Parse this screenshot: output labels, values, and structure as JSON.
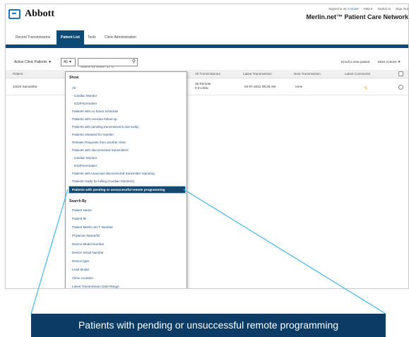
{
  "header": {
    "logo_text": "Abbott",
    "signed_in_prefix": "Signed in as",
    "user_name": "A Grant",
    "help_label": "Help ▾",
    "switch_label": "Switch to",
    "signout_label": "Sign Out",
    "network_title": "Merlin.net™ Patient Care Network"
  },
  "tabs": [
    {
      "label": "Recent Transmissions"
    },
    {
      "label": "Patient List"
    },
    {
      "label": "Tools"
    },
    {
      "label": "Clinic Administration"
    }
  ],
  "toolbar": {
    "filter_label": "Active Clinic Patients ▼",
    "filter_value": "All ▼",
    "search_placeholder": "Search by Name, ID, D",
    "enroll_label": "Enroll a new patient",
    "more_actions_label": "More Actions ▼"
  },
  "table": {
    "columns": [
      "Patient",
      "All Transmissions",
      "Latest Transmission",
      "Next Transmission",
      "Latest Comments"
    ],
    "rows": [
      {
        "patient": "Jones Samantha",
        "transmissions_line1": "25 Remote",
        "transmissions_line2": "0 In-clinic",
        "latest": "04-07-2022 08:25 AM",
        "next": "none"
      }
    ]
  },
  "dropdown": {
    "show_heading": "Show",
    "show_items": [
      "All",
      "- Cardiac Monitor",
      "- ICD/Pacemaker",
      "Patients with no future schedule",
      "Patients with overdue follow-up",
      "Patients with pending transmissions due today",
      "Patients released for transfer",
      "Release Requests from another clinic",
      "Patients with disconnected transmitters",
      "- Cardiac Monitor",
      "- ICD/Pacemaker",
      "Patients with unaccept disconnected transmitter reporting",
      "Patients ready for billing (Cardiac Monitors)",
      "Patients with pending or unsuccessful remote programming"
    ],
    "selected_index": 13,
    "search_heading": "Search By",
    "search_items": [
      "Patient Name",
      "Patient ID",
      "Patient Merlin.net™ Number",
      "Physician Name/ID",
      "Device Model Number",
      "Device Serial Number",
      "Device type",
      "Lead Model",
      "Clinic Location",
      "Latest Transmission Date Range"
    ]
  },
  "callout": {
    "text": "Patients with pending or unsuccessful remote programming"
  },
  "colors": {
    "brand_blue": "#1976c6",
    "nav_dark": "#0c4a76",
    "callout_bg": "#0c3c66",
    "callout_line": "#3fb6e8",
    "comment_icon": "#e6a61e"
  }
}
